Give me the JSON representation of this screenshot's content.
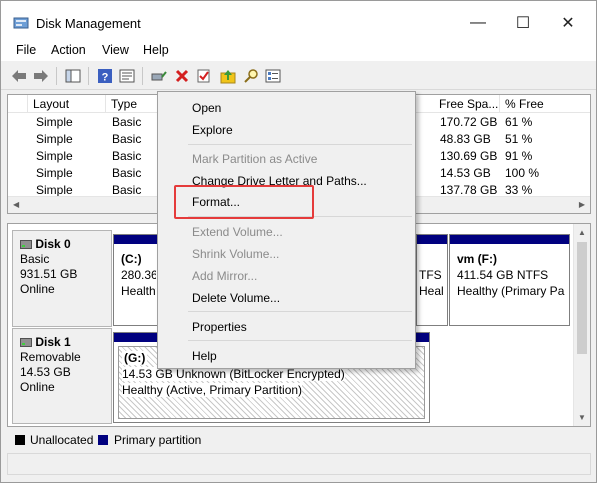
{
  "window": {
    "title": "Disk Management",
    "controls": {
      "minimize": "—",
      "maximize": "☐",
      "close": "✕"
    }
  },
  "menu": [
    "File",
    "Action",
    "View",
    "Help"
  ],
  "toolbar": {
    "icons": [
      "back-arrow-icon",
      "forward-arrow-icon",
      "console-tree-icon",
      "help-icon",
      "properties-icon",
      "connect-icon",
      "delete-icon",
      "checkmark-icon",
      "up-folder-icon",
      "search-icon",
      "list-view-icon"
    ]
  },
  "volume_list": {
    "columns": [
      "Layout",
      "Type",
      "Free Spa...",
      "% Free"
    ],
    "rows": [
      {
        "layout": "Simple",
        "type": "Basic",
        "free": "170.72 GB",
        "pct": "61 %"
      },
      {
        "layout": "Simple",
        "type": "Basic",
        "free": "48.83 GB",
        "pct": "51 %"
      },
      {
        "layout": "Simple",
        "type": "Basic",
        "free": "130.69 GB",
        "pct": "91 %"
      },
      {
        "layout": "Simple",
        "type": "Basic",
        "free": "14.53 GB",
        "pct": "100 %"
      },
      {
        "layout": "Simple",
        "type": "Basic",
        "free": "137.78 GB",
        "pct": "33 %"
      }
    ]
  },
  "disks": [
    {
      "name": "Disk 0",
      "type": "Basic",
      "size": "931.51 GB",
      "status": "Online",
      "partitions": [
        {
          "label": "(C:)",
          "line1": "280.36 (",
          "line2": "Healthy"
        },
        {
          "label": "",
          "line1": "TFS",
          "line2": "Healthy (P"
        },
        {
          "label": "vm  (F:)",
          "line1": "411.54 GB NTFS",
          "line2": "Healthy (Primary Pa"
        }
      ]
    },
    {
      "name": "Disk 1",
      "type": "Removable",
      "size": "14.53 GB",
      "status": "Online",
      "partitions": [
        {
          "label": "(G:)",
          "line1": "14.53 GB Unknown (BitLocker Encrypted)",
          "line2": "Healthy (Active, Primary Partition)"
        }
      ]
    }
  ],
  "legend": [
    {
      "label": "Unallocated",
      "color": "#000000"
    },
    {
      "label": "Primary partition",
      "color": "#00007f"
    }
  ],
  "context_menu": [
    {
      "label": "Open",
      "enabled": true
    },
    {
      "label": "Explore",
      "enabled": true
    },
    {
      "label": "Mark Partition as Active",
      "enabled": false
    },
    {
      "label": "Change Drive Letter and Paths...",
      "enabled": true
    },
    {
      "label": "Format...",
      "enabled": true,
      "highlighted": true
    },
    {
      "label": "Extend Volume...",
      "enabled": false
    },
    {
      "label": "Shrink Volume...",
      "enabled": false
    },
    {
      "label": "Add Mirror...",
      "enabled": false
    },
    {
      "label": "Delete Volume...",
      "enabled": true
    },
    {
      "label": "Properties",
      "enabled": true
    },
    {
      "label": "Help",
      "enabled": true
    }
  ],
  "colors": {
    "primary_partition": "#00007f",
    "highlight_box": "#e53b3b"
  }
}
